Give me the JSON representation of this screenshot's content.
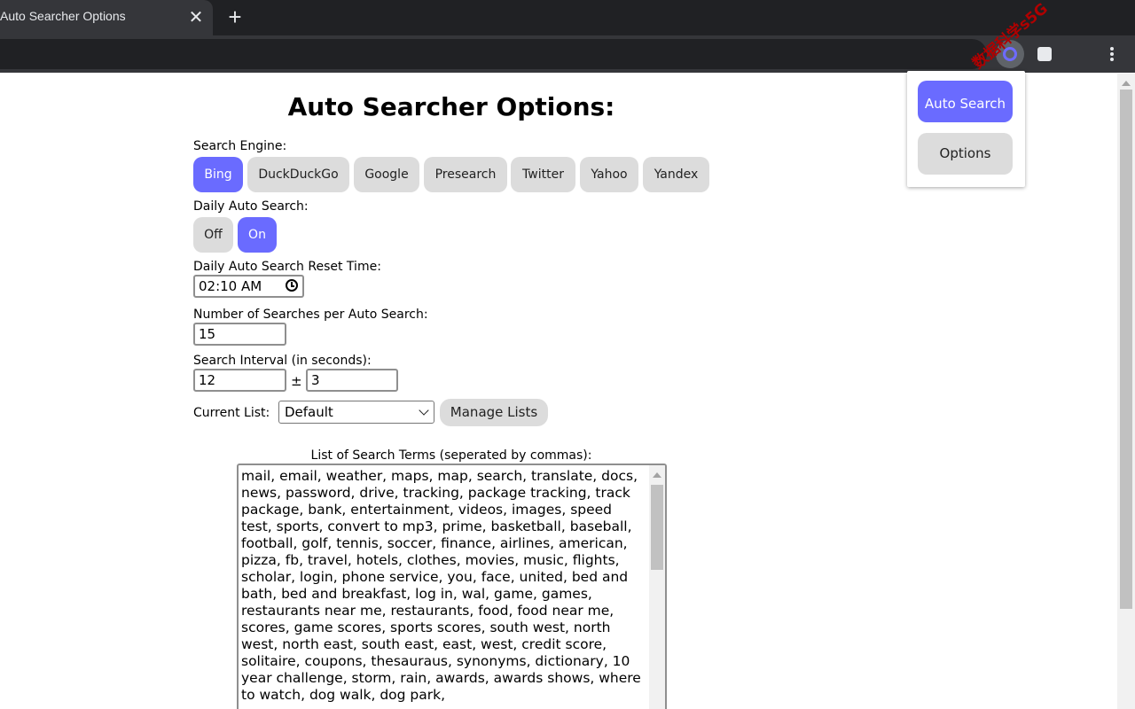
{
  "browser": {
    "tab_title": "Auto Searcher Options",
    "tab_close_glyph": "✕",
    "new_tab_glyph": "+",
    "watermark": "数据科学s5G"
  },
  "page": {
    "title": "Auto Searcher Options:",
    "search_engine_label": "Search Engine:",
    "engines": [
      {
        "label": "Bing",
        "active": true
      },
      {
        "label": "DuckDuckGo",
        "active": false
      },
      {
        "label": "Google",
        "active": false
      },
      {
        "label": "Presearch",
        "active": false
      },
      {
        "label": "Twitter",
        "active": false
      },
      {
        "label": "Yahoo",
        "active": false
      },
      {
        "label": "Yandex",
        "active": false
      }
    ],
    "daily_label": "Daily Auto Search:",
    "daily_off": "Off",
    "daily_on": "On",
    "reset_time_label": "Daily Auto Search Reset Time:",
    "reset_time_value": "02:10 AM",
    "num_searches_label": "Number of Searches per Auto Search:",
    "num_searches_value": "15",
    "interval_label": "Search Interval (in seconds):",
    "interval_value": "12",
    "interval_pm": "±",
    "interval_variance": "3",
    "current_list_label": "Current List:",
    "current_list_value": "Default",
    "manage_lists": "Manage Lists",
    "terms_label": "List of Search Terms (seperated by commas):",
    "terms_text": "mail, email, weather, maps, map, search, translate, docs, news, password, drive, tracking, package tracking, track package, bank, entertainment, videos, images, speed test, sports, convert to mp3, prime, basketball, baseball, football, golf, tennis, soccer, finance, airlines, american, pizza, fb, travel, hotels, clothes, movies, music, flights, scholar, login, phone service, you, face, united, bed and bath, bed and breakfast, log in, wal, game, games, restaurants near me, restaurants, food, food near me, scores, game scores, sports scores, south west, north west, north east, south east, east, west, credit score, solitaire, coupons, thesauraus, synonyms, dictionary, 10 year challenge, storm, rain, awards, awards shows, where to watch, dog walk, dog park,"
  },
  "popup": {
    "auto_search": "Auto Search",
    "options": "Options"
  },
  "colors": {
    "accent": "#6a6bff",
    "button_gray": "#dcdcdc",
    "chrome_dark": "#202124"
  }
}
